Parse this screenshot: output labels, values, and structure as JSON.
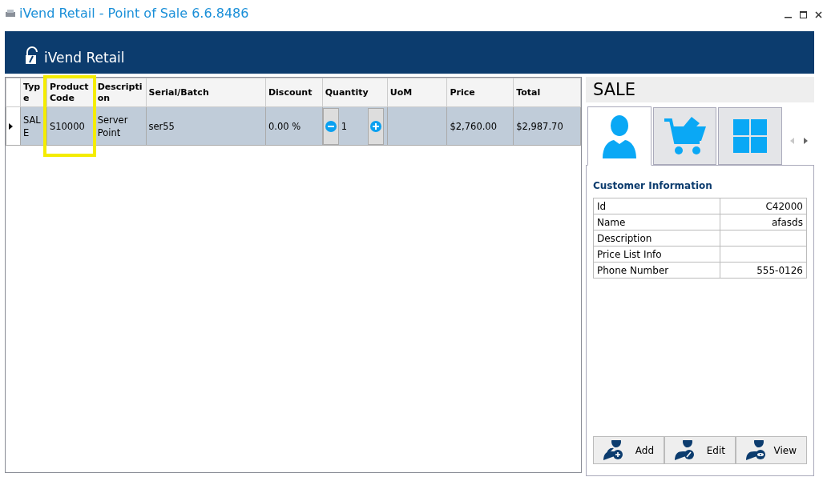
{
  "window": {
    "title": "iVend Retail - Point of Sale 6.6.8486"
  },
  "header": {
    "logo_text": "iVend Retail"
  },
  "grid": {
    "columns": [
      {
        "label": "Type",
        "highlighted": false
      },
      {
        "label": "Product Code",
        "highlighted": true
      },
      {
        "label": "Description",
        "highlighted": false
      },
      {
        "label": "Serial/Batch",
        "highlighted": false
      },
      {
        "label": "Discount",
        "highlighted": false
      },
      {
        "label": "Quantity",
        "highlighted": false
      },
      {
        "label": "UoM",
        "highlighted": false
      },
      {
        "label": "Price",
        "highlighted": false
      },
      {
        "label": "Total",
        "highlighted": false
      }
    ],
    "rows": [
      {
        "selected": true,
        "type": "SALE",
        "product_code": "S10000",
        "description": "Server Point",
        "serial_batch": "ser55",
        "discount": "0.00 %",
        "quantity": "1",
        "price": "$2,760.00",
        "total": "$2,987.70"
      }
    ]
  },
  "panel": {
    "title": "SALE",
    "tabs": [
      {
        "kind": "customer",
        "selected": true
      },
      {
        "kind": "cart",
        "selected": false
      },
      {
        "kind": "tiles",
        "selected": false
      }
    ],
    "section_title": "Customer Information",
    "fields": [
      {
        "label": "Id",
        "value": "C42000"
      },
      {
        "label": "Name",
        "value": "afasds"
      },
      {
        "label": "Description"
      },
      {
        "label": "Price List Info"
      },
      {
        "label": "Phone Number",
        "value": "555-0126"
      }
    ],
    "buttons": [
      {
        "kind": "add",
        "label": "Add"
      },
      {
        "kind": "edit",
        "label": "Edit"
      },
      {
        "kind": "view",
        "label": "View"
      }
    ]
  }
}
